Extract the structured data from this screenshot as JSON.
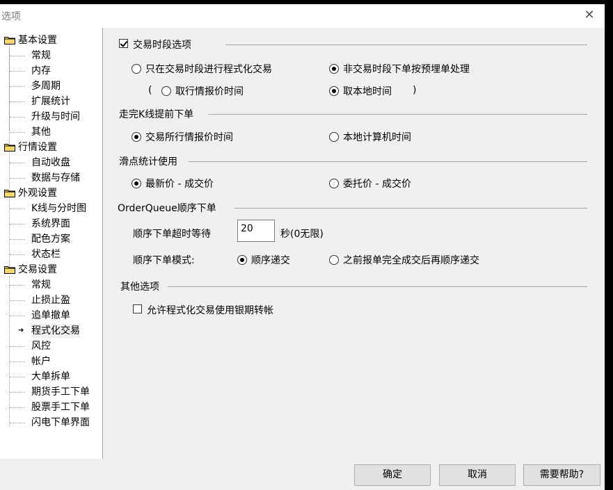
{
  "window": {
    "title": "选项",
    "close_symbol": "✕"
  },
  "tree": {
    "groups": [
      {
        "label": "基本设置",
        "children": [
          "常规",
          "内存",
          "多周期",
          "扩展统计",
          "升级与时间",
          "其他"
        ]
      },
      {
        "label": "行情设置",
        "children": [
          "自动收盘",
          "数据与存储"
        ]
      },
      {
        "label": "外观设置",
        "children": [
          "K线与分时图",
          "系统界面",
          "配色方案",
          "状态栏"
        ]
      },
      {
        "label": "交易设置",
        "children": [
          "常规",
          "止损止盈",
          "追单撤单",
          "程式化交易",
          "风控",
          "帐户",
          "大单拆单",
          "期货手工下单",
          "股票手工下单",
          "闪电下单界面"
        ]
      }
    ],
    "selected": "程式化交易"
  },
  "sections": {
    "trading_period": {
      "checkbox_label": "交易时段选项",
      "checked": true,
      "opt_only_trading": "只在交易时段进行程式化交易",
      "opt_non_trading": "非交易时段下单按预埋单处理",
      "paren_open": "(",
      "paren_close": ")",
      "opt_quote_time": "取行情报价时间",
      "opt_local_time": "取本地时间"
    },
    "kline_early": {
      "title": "走完K线提前下单",
      "opt_exchange_time": "交易所行情报价时间",
      "opt_local_computer": "本地计算机时间"
    },
    "slippage": {
      "title": "滑点统计使用",
      "opt_latest": "最新价 - 成交价",
      "opt_order": "委托价 - 成交价"
    },
    "order_queue": {
      "title": "OrderQueue顺序下单",
      "timeout_label": "顺序下单超时等待",
      "timeout_value": "20",
      "timeout_unit": "秒(0无限)",
      "mode_label": "顺序下单模式:",
      "opt_sequential": "顺序递交",
      "opt_after_fill": "之前报单完全成交后再顺序递交"
    },
    "other": {
      "title": "其他选项",
      "allow_silver_label": "允许程式化交易使用银期转帐",
      "checked": false
    }
  },
  "footer": {
    "ok": "确定",
    "cancel": "取消",
    "help": "需要帮助?"
  }
}
